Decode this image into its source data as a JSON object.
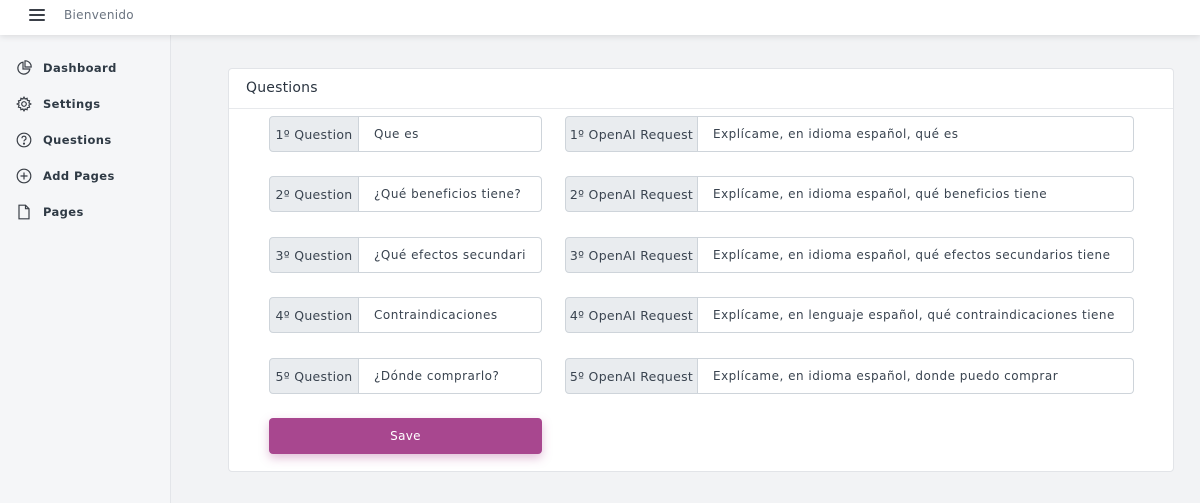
{
  "topbar": {
    "title": "Bienvenido"
  },
  "sidebar": {
    "items": [
      {
        "label": "Dashboard"
      },
      {
        "label": "Settings"
      },
      {
        "label": "Questions"
      },
      {
        "label": "Add Pages"
      },
      {
        "label": "Pages"
      }
    ]
  },
  "card": {
    "title": "Questions",
    "questions": [
      {
        "label": "1º Question",
        "value": "Que es"
      },
      {
        "label": "2º Question",
        "value": "¿Qué beneficios tiene?"
      },
      {
        "label": "3º Question",
        "value": "¿Qué efectos secundarios"
      },
      {
        "label": "4º Question",
        "value": "Contraindicaciones"
      },
      {
        "label": "5º Question",
        "value": "¿Dónde comprarlo?"
      }
    ],
    "requests": [
      {
        "label": "1º OpenAI Request",
        "value": "Explícame, en idioma español, qué es"
      },
      {
        "label": "2º OpenAI Request",
        "value": "Explícame, en idioma español, qué beneficios tiene"
      },
      {
        "label": "3º OpenAI Request",
        "value": "Explícame, en idioma español, qué efectos secundarios tiene"
      },
      {
        "label": "4º OpenAI Request",
        "value": "Explícame, en lenguaje español, qué contraindicaciones tiene"
      },
      {
        "label": "5º OpenAI Request",
        "value": "Explícame, en idioma español, donde puedo comprar"
      }
    ],
    "save_label": "Save"
  },
  "colors": {
    "accent": "#a8478f",
    "addon_bg": "#e9ecef",
    "border": "#ced4da"
  }
}
